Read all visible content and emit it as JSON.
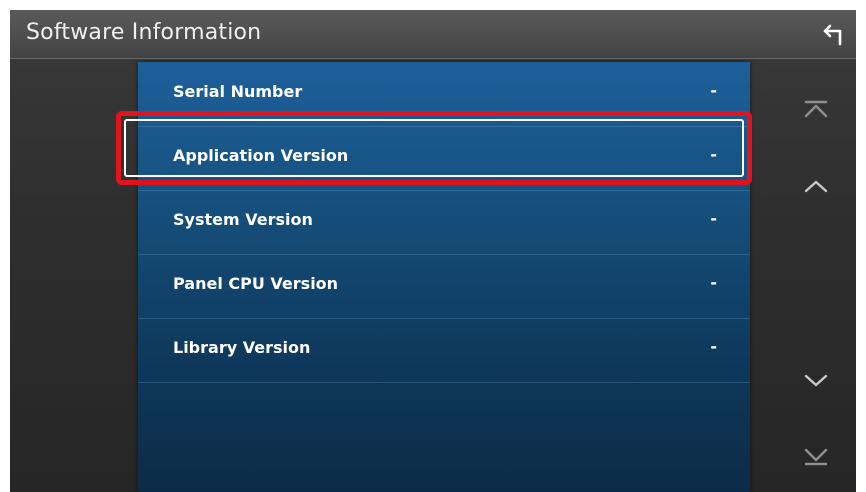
{
  "header": {
    "title": "Software Information",
    "back_icon": "back-arrow-icon"
  },
  "list": {
    "items": [
      {
        "label": "Serial Number",
        "value": "-"
      },
      {
        "label": "Application Version",
        "value": "-"
      },
      {
        "label": "System Version",
        "value": "-"
      },
      {
        "label": "Panel CPU Version",
        "value": "-"
      },
      {
        "label": "Library Version",
        "value": "-"
      }
    ],
    "selected_label": "Application Version"
  },
  "scrollbar": {
    "icons": [
      "scroll-top-icon",
      "scroll-up-icon",
      "scroll-down-icon",
      "scroll-bottom-icon"
    ]
  },
  "colors": {
    "highlight": "#e0141e",
    "panel_top": "#1e5f9b",
    "panel_bottom": "#0b2a44"
  }
}
